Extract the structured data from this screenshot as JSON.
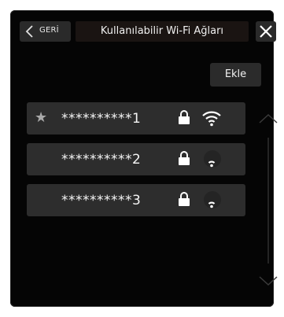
{
  "header": {
    "back_label": "GERİ",
    "title": "Kullanılabilir Wi-Fi Ağları",
    "close_icon": "close-icon"
  },
  "actions": {
    "add_label": "Ekle"
  },
  "networks": [
    {
      "ssid": "**********1",
      "favorite": true,
      "secured": true,
      "signal_bars": 3
    },
    {
      "ssid": "**********2",
      "favorite": false,
      "secured": true,
      "signal_bars": 1
    },
    {
      "ssid": "**********3",
      "favorite": false,
      "secured": true,
      "signal_bars": 1
    }
  ],
  "icons": {
    "back": "chevron-left-icon",
    "favorite": "star-icon",
    "lock": "lock-icon",
    "wifi": "wifi-icon",
    "scroll_up": "chevron-up-icon",
    "scroll_down": "chevron-down-icon"
  },
  "colors": {
    "panel_bg": "#050505",
    "row_bg": "#2d2d2d",
    "button_bg": "#2a2a2a",
    "text": "#f5f5f5",
    "muted": "#a9a9a9"
  }
}
